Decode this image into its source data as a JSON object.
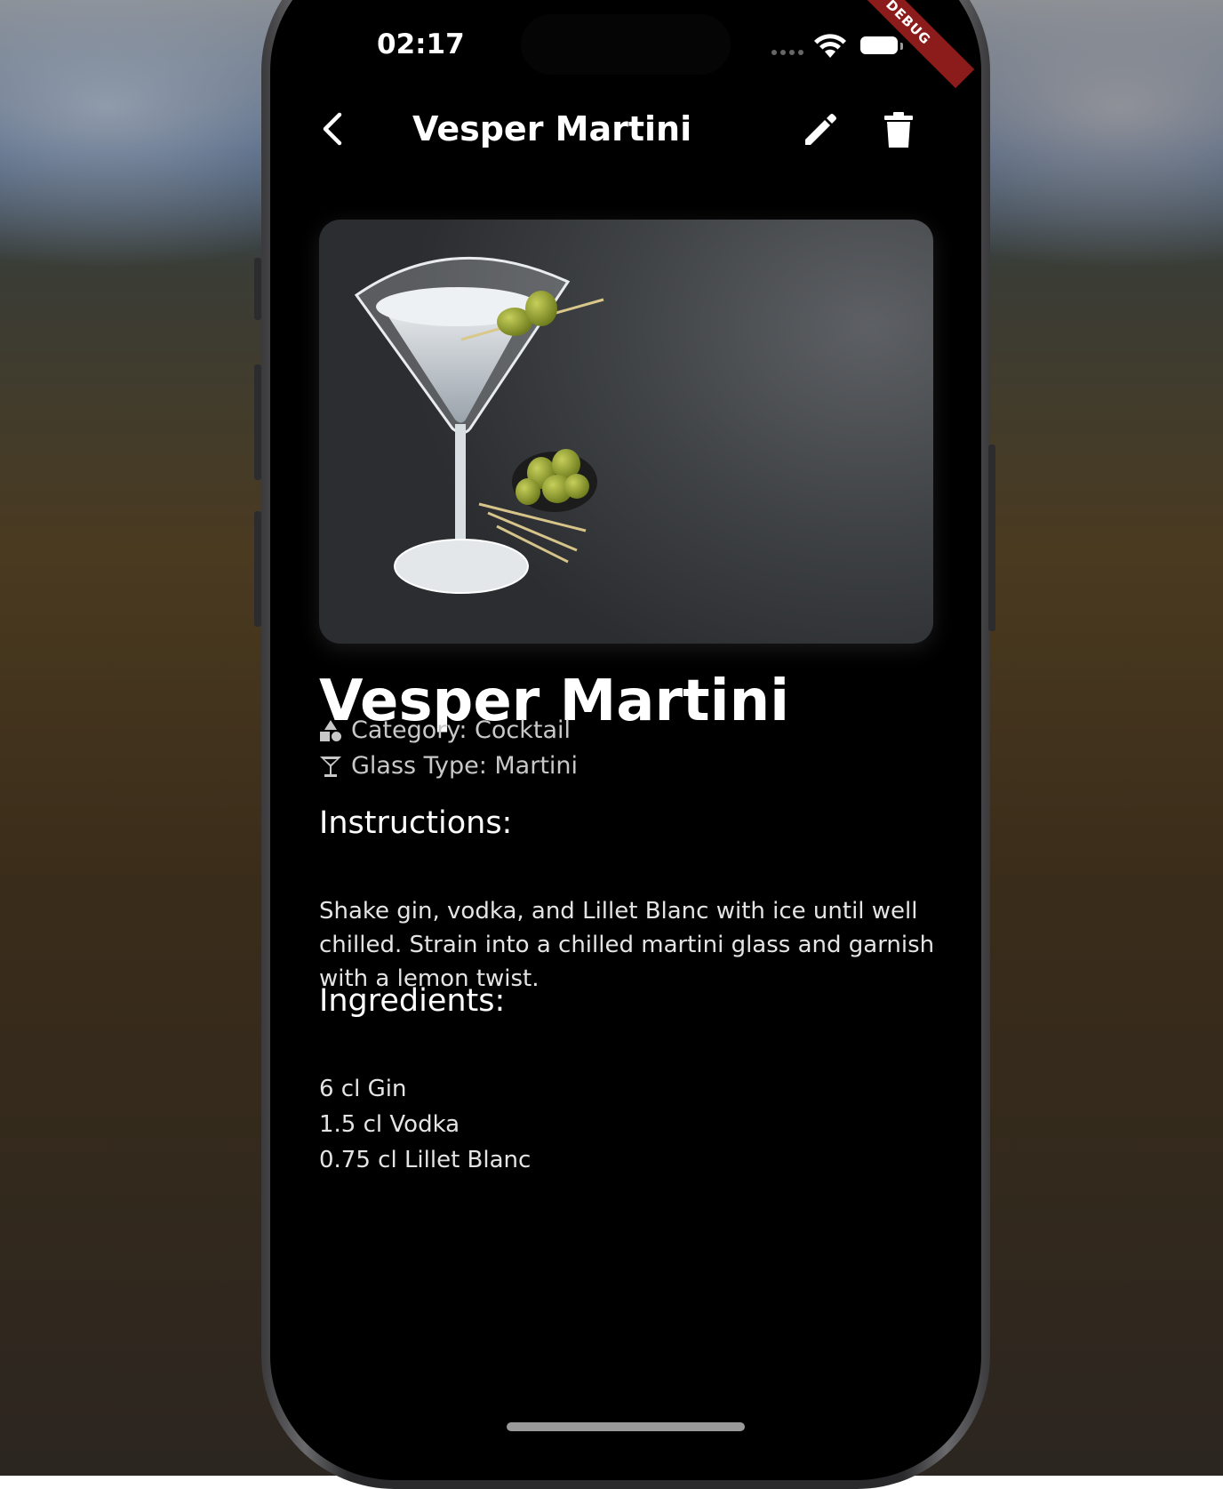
{
  "status_bar": {
    "time": "02:17",
    "debug_banner": "DEBUG"
  },
  "navbar": {
    "title": "Vesper Martini",
    "back_icon": "chevron-left-icon",
    "edit_icon": "pencil-icon",
    "delete_icon": "trash-icon"
  },
  "drink": {
    "name": "Vesper Martini",
    "category": "Category: Cocktail",
    "category_icon": "shapes-icon",
    "glass": "Glass Type: Martini",
    "glass_icon": "martini-glass-icon",
    "image_subject": "martini glass with olives"
  },
  "instructions": {
    "heading": "Instructions:",
    "text": "Shake gin, vodka, and Lillet Blanc with ice until well chilled. Strain into a chilled martini glass and garnish with a lemon twist."
  },
  "ingredients": {
    "heading": "Ingredients:",
    "items": [
      "6 cl Gin",
      "1.5 cl Vodka",
      "0.75 cl Lillet Blanc"
    ]
  },
  "colors": {
    "background": "#000000",
    "text_primary": "#ffffff",
    "text_secondary": "#c8c8c8",
    "debug_banner": "#8c1b1b"
  }
}
